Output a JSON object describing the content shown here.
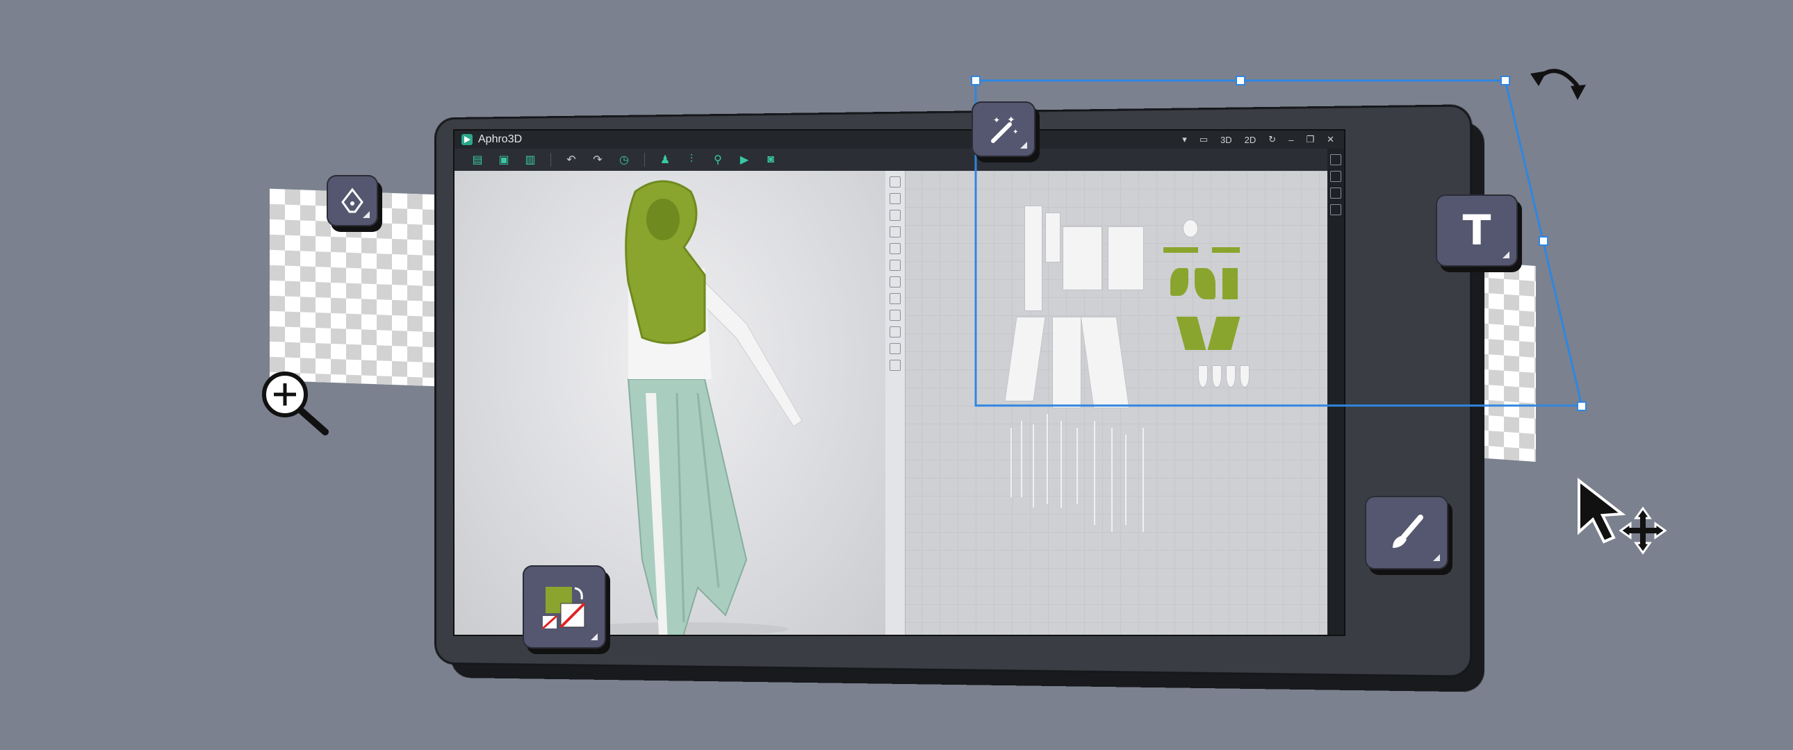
{
  "app": {
    "title": "Aphro3D"
  },
  "titlebar": {
    "view_3d": "3D",
    "view_2d": "2D"
  },
  "icons": {
    "pen": "pen-tool-icon",
    "magic": "magic-wand-icon",
    "text": "T",
    "brush": "brush-icon",
    "zoom": "zoom-in-icon",
    "swatch": "color-swatch-icon",
    "rotate": "rotate-arrow-icon",
    "cursor": "cursor-move-icon"
  },
  "colors": {
    "background": "#7b818e",
    "accent": "#39c8a6",
    "selection": "#2f86e0",
    "fabric_green": "#8aa52d",
    "fabric_mint": "#a9cdbf",
    "tile": "#555770"
  }
}
